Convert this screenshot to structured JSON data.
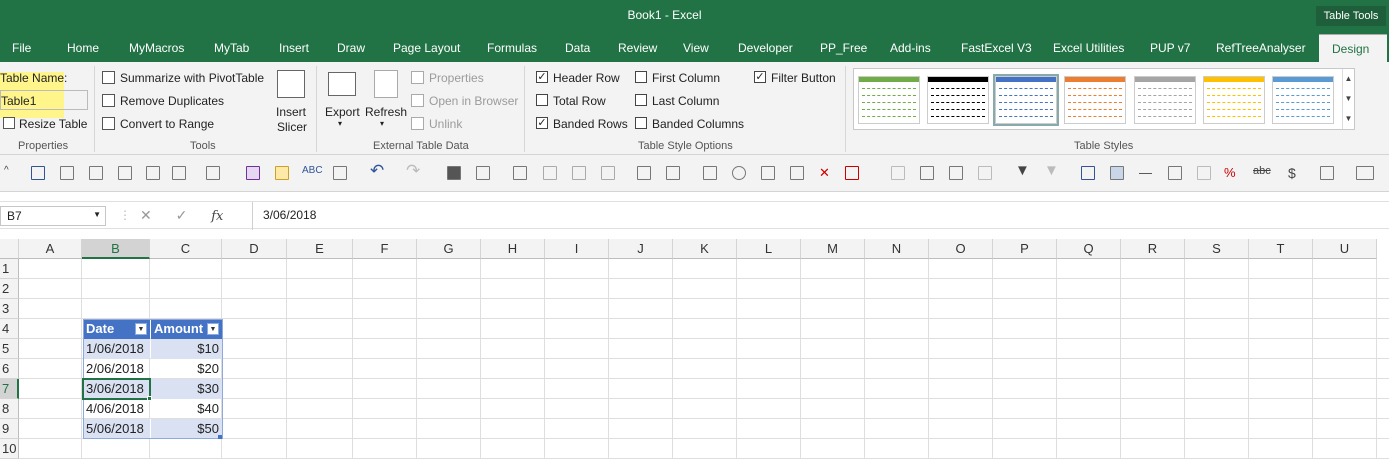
{
  "window": {
    "title": "Book1  -  Excel",
    "context_group": "Table Tools"
  },
  "tabs": [
    "File",
    "Home",
    "MyMacros",
    "MyTab",
    "Insert",
    "Draw",
    "Page Layout",
    "Formulas",
    "Data",
    "Review",
    "View",
    "Developer",
    "PP_Free",
    "Add-ins",
    "FastExcel V3",
    "Excel Utilities",
    "PUP v7",
    "RefTreeAnalyser",
    "Design"
  ],
  "active_tab": "Design",
  "ribbon": {
    "properties": {
      "name_label": "Table Name:",
      "name_value": "Table1",
      "resize": "Resize Table",
      "group": "Properties"
    },
    "tools": {
      "pivot": "Summarize with PivotTable",
      "dupes": "Remove Duplicates",
      "convert": "Convert to Range",
      "slicer1": "Insert",
      "slicer2": "Slicer",
      "group": "Tools"
    },
    "external": {
      "export": "Export",
      "refresh": "Refresh",
      "properties": "Properties",
      "browser": "Open in Browser",
      "unlink": "Unlink",
      "group": "External Table Data"
    },
    "style_options": {
      "header_row": "Header Row",
      "total_row": "Total Row",
      "banded_rows": "Banded Rows",
      "first_column": "First Column",
      "last_column": "Last Column",
      "banded_columns": "Banded Columns",
      "filter_button": "Filter Button",
      "group": "Table Style Options"
    },
    "checked": {
      "header_row": true,
      "total_row": false,
      "banded_rows": true,
      "first_column": false,
      "last_column": false,
      "banded_columns": false,
      "filter_button": true
    },
    "styles": {
      "group": "Table Styles",
      "swatch_colors": [
        "#70ad47",
        "#000000",
        "#4472c4",
        "#ed7d31",
        "#a5a5a5",
        "#ffc000",
        "#5b9bd5"
      ]
    }
  },
  "formula_bar": {
    "name_box": "B7",
    "fx": "fx",
    "formula": "3/06/2018"
  },
  "columns": [
    "A",
    "B",
    "C",
    "D",
    "E",
    "F",
    "G",
    "H",
    "I",
    "J",
    "K",
    "L",
    "M",
    "N",
    "O",
    "P",
    "Q",
    "R",
    "S",
    "T",
    "U"
  ],
  "rows": [
    "1",
    "2",
    "3",
    "4",
    "5",
    "6",
    "7",
    "8",
    "9",
    "10"
  ],
  "table": {
    "headers": [
      "Date",
      "Amount"
    ],
    "rows": [
      [
        "1/06/2018",
        "$10"
      ],
      [
        "2/06/2018",
        "$20"
      ],
      [
        "3/06/2018",
        "$30"
      ],
      [
        "4/06/2018",
        "$40"
      ],
      [
        "5/06/2018",
        "$50"
      ]
    ]
  },
  "colors": {
    "accent": "#217346",
    "table_header": "#4472c4",
    "table_band": "#d9e1f2",
    "highlight": "#fff58a"
  }
}
